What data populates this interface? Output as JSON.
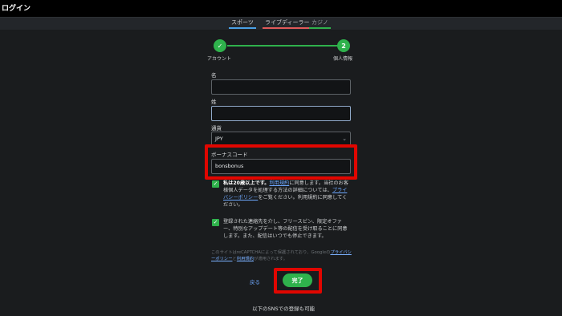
{
  "header": {
    "title": "ログイン"
  },
  "tabs": [
    {
      "label": "スポーツ"
    },
    {
      "label": "ライブディーラー"
    },
    {
      "label": "カジノ"
    }
  ],
  "stepper": {
    "step1": {
      "number": "✓",
      "label": "アカウント"
    },
    "step2": {
      "number": "2",
      "label": "個人情報"
    }
  },
  "form": {
    "first_name": {
      "label": "名",
      "value": ""
    },
    "last_name": {
      "label": "姓",
      "value": ""
    },
    "currency": {
      "label": "通貨",
      "value": "JPY"
    },
    "bonus_code": {
      "label": "ボーナスコード",
      "value": "bonsbonus"
    }
  },
  "consent": {
    "age": {
      "bold": "私は20歳以上です。",
      "link1": "利用規約",
      "text1": "に同意します。当社のお客様個人データを処理する方法の詳細については、",
      "link2": "プライバシーポリシー",
      "text2": "をご覧ください。利用規約に同意してください。"
    },
    "marketing": {
      "text": "登録された連絡先を介し、フリースピン、限定オファー、特別なアップデート等の配信を受け取ることに同意します。また、配信はいつでも停止できます。"
    }
  },
  "recaptcha": {
    "text1": "このサイトはreCAPTCHAによって保護されており、Googleの",
    "link1": "プライバシーポリシー",
    "sep": "と",
    "link2": "利用規約",
    "text2": "が適用されます。"
  },
  "actions": {
    "back_label": "戻る",
    "done_label": "完了"
  },
  "footer": {
    "sns_text": "以下のSNSでの登録も可能"
  },
  "colors": {
    "accent": "#2fb24c",
    "highlight": "#e10600",
    "link": "#6ea8ff"
  }
}
